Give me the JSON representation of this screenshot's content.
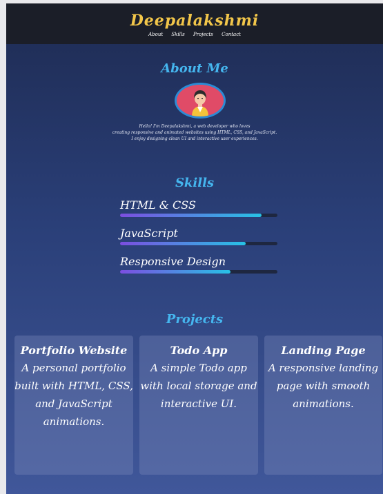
{
  "header": {
    "brand": "Deepalakshmi",
    "nav": [
      "About",
      "Skills",
      "Projects",
      "Contact"
    ]
  },
  "about": {
    "title": "About Me",
    "line1": "Hello! I'm Deepalakshmi, a web developer who loves",
    "line2": "creating responsive and animated websites using HTML, CSS, and JavaScript.",
    "line3": "I enjoy designing clean UI and interactive user experiences."
  },
  "skills": {
    "title": "Skills",
    "items": [
      {
        "label": "HTML & CSS",
        "level": 0.9
      },
      {
        "label": "JavaScript",
        "level": 0.8
      },
      {
        "label": "Responsive Design",
        "level": 0.7
      }
    ]
  },
  "projects": {
    "title": "Projects",
    "items": [
      {
        "title": "Portfolio Website",
        "desc": "A personal portfolio built with HTML, CSS, and JavaScript animations."
      },
      {
        "title": "Todo App",
        "desc": "A simple Todo app with local storage and interactive UI."
      },
      {
        "title": "Landing Page",
        "desc": "A responsive landing page with smooth animations."
      }
    ]
  },
  "colors": {
    "accent": "#45b6ef",
    "brand": "#f2c64a",
    "header_bg": "#1b1e28"
  }
}
